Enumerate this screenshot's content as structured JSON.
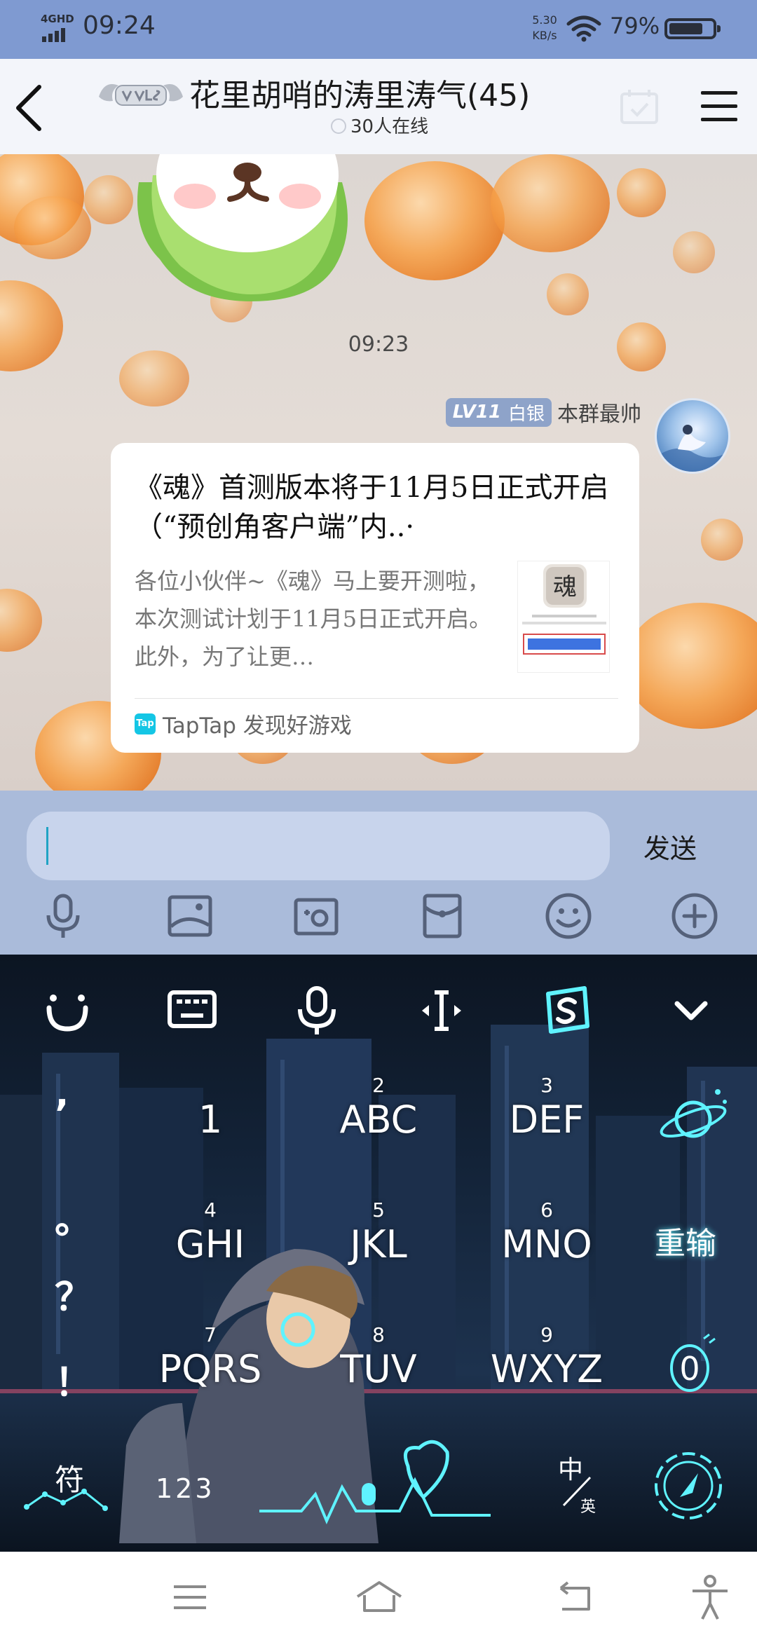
{
  "status_bar": {
    "network": "4GHD",
    "time": "09:24",
    "speed_value": "5.30",
    "speed_unit": "KB/s",
    "battery_percent": "79%",
    "battery_level": 0.79
  },
  "header": {
    "title": "花里胡哨的涛里涛气(45)",
    "online": "30人在线"
  },
  "chat": {
    "timestamp": "09:23",
    "sender": {
      "level": "LV11",
      "rank": "白银",
      "name": "本群最帅"
    },
    "card": {
      "title": "《魂》首测版本将于11月5日正式开启（“预创角客户端”内..·",
      "description": "各位小伙伴~《魂》马上要开测啦，本次测试计划于11月5日正式开启。此外，为了让更…",
      "source_logo": "Tap",
      "source": "TapTap 发现好游戏",
      "thumb_badge": "魂"
    }
  },
  "input": {
    "value": "",
    "send_label": "发送"
  },
  "keyboard": {
    "punct": [
      "’",
      "。",
      "？",
      "！"
    ],
    "keys": [
      {
        "num": "",
        "letters": "1"
      },
      {
        "num": "2",
        "letters": "ABC"
      },
      {
        "num": "3",
        "letters": "DEF"
      },
      {
        "num": "4",
        "letters": "GHI"
      },
      {
        "num": "5",
        "letters": "JKL"
      },
      {
        "num": "6",
        "letters": "MNO"
      },
      {
        "num": "7",
        "letters": "PQRS"
      },
      {
        "num": "8",
        "letters": "TUV"
      },
      {
        "num": "9",
        "letters": "WXYZ"
      }
    ],
    "reinput_label": "重输",
    "zero_label": "0",
    "symbol_label": "符",
    "numeric_label": "123",
    "lang_zh": "中",
    "lang_en": "英"
  },
  "colors": {
    "status_bar": "#7f9ad1",
    "input_area": "#aabbda",
    "neon": "#5ff3ff"
  }
}
